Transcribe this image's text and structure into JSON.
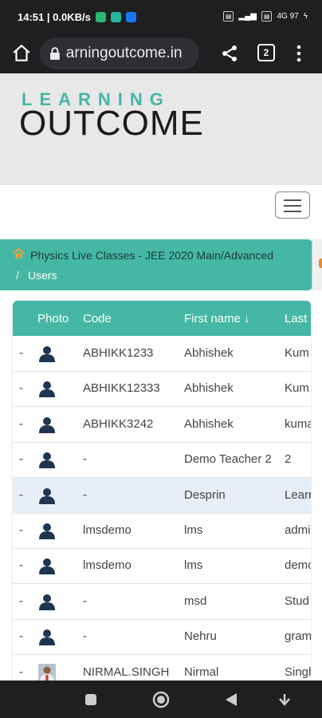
{
  "status_bar": {
    "time_data": "14:51 | 0.0KB/s",
    "right_text": "4G 97"
  },
  "browser": {
    "url": "arningoutcome.in",
    "tab_count": "2"
  },
  "logo": {
    "top": "LEARNING",
    "bottom": "OUTCOME"
  },
  "breadcrumb": {
    "course": "Physics Live Classes - JEE 2020 Main/Advanced",
    "separator": "/",
    "current": "Users"
  },
  "table": {
    "headers": {
      "photo": "Photo",
      "code": "Code",
      "first_name": "First name ↓",
      "last_name": "Last"
    },
    "rows": [
      {
        "dash": "-",
        "code": "ABHIKK1233",
        "first": "Abhishek",
        "last": "Kum"
      },
      {
        "dash": "-",
        "code": "ABHIKK12333",
        "first": "Abhishek",
        "last": "Kum"
      },
      {
        "dash": "-",
        "code": "ABHIKK3242",
        "first": "Abhishek",
        "last": "kuma"
      },
      {
        "dash": "-",
        "code": "-",
        "first": "Demo Teacher 2",
        "last": "2"
      },
      {
        "dash": "-",
        "code": "-",
        "first": "Desprin",
        "last": "Learn"
      },
      {
        "dash": "-",
        "code": "lmsdemo",
        "first": "lms",
        "last": "admi"
      },
      {
        "dash": "-",
        "code": "lmsdemo",
        "first": "lms",
        "last": "demo"
      },
      {
        "dash": "-",
        "code": "-",
        "first": "msd",
        "last": "Stud"
      },
      {
        "dash": "-",
        "code": "-",
        "first": "Nehru",
        "last": "gram"
      },
      {
        "dash": "-",
        "code": "NIRMAL.SINGH",
        "first": "Nirmal",
        "last": "Singh"
      }
    ]
  },
  "colors": {
    "accent": "#44b8a4",
    "highlight_row": "#e7eef8",
    "dark_bar": "#1f1f22"
  }
}
